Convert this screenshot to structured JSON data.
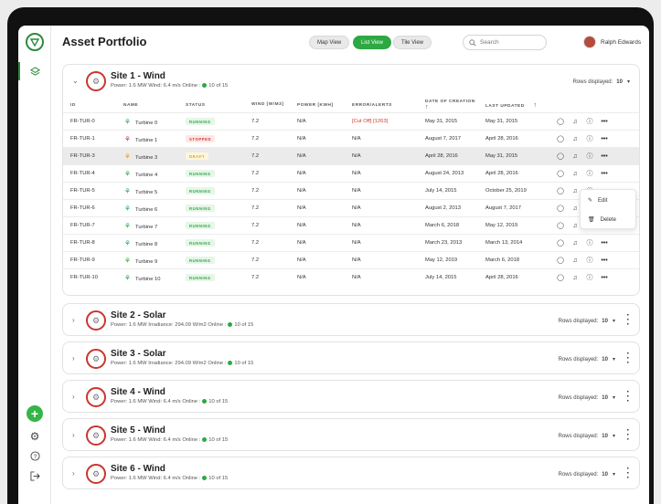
{
  "header": {
    "title": "Asset Portfolio",
    "views": [
      "Map View",
      "List View",
      "Tile View"
    ],
    "active_view": "List View",
    "search_placeholder": "Search",
    "user_name": "Ralph Edwards"
  },
  "colors": {
    "accent": "#2da843",
    "stopped": "#d33a2f",
    "draft": "#d9a321"
  },
  "expanded_site": {
    "name": "Site 1 - Wind",
    "power": "Power: 1.6 MW",
    "metric": "Wind: 6.4 m/s",
    "online_label": "Online :",
    "online_value": "10 of 15",
    "rows_label": "Rows displayed:",
    "rows_value": "10",
    "columns": [
      "ID",
      "NAME",
      "STATUS",
      "WIND [W/M3]",
      "POWER [KWH]",
      "ERROR/ALERTS",
      "DATE OF CREATION",
      "LAST UPDATED"
    ],
    "rows": [
      {
        "id": "FR-TUR-0",
        "name": "Turbine 0",
        "status": "RUNNING",
        "kind": "run",
        "wind": "7.2",
        "power": "N/A",
        "error": "[Cut Off] [1263]",
        "created": "May 31, 2015",
        "updated": "May 31, 2015"
      },
      {
        "id": "FR-TUR-1",
        "name": "Turbine 1",
        "status": "STOPPED",
        "kind": "stop",
        "wind": "7.2",
        "power": "N/A",
        "error": "N/A",
        "created": "August 7, 2017",
        "updated": "April 28, 2016"
      },
      {
        "id": "FR-TUR-3",
        "name": "Turbine 3",
        "status": "DRAFT",
        "kind": "draft",
        "wind": "7.2",
        "power": "N/A",
        "error": "N/A",
        "created": "April 28, 2016",
        "updated": "May 31, 2015"
      },
      {
        "id": "FR-TUR-4",
        "name": "Turbine 4",
        "status": "RUNNING",
        "kind": "run",
        "wind": "7.2",
        "power": "N/A",
        "error": "N/A",
        "created": "August 24, 2013",
        "updated": "April 28, 2016"
      },
      {
        "id": "FR-TUR-5",
        "name": "Turbine 5",
        "status": "RUNNING",
        "kind": "run",
        "wind": "7.2",
        "power": "N/A",
        "error": "N/A",
        "created": "July 14, 2015",
        "updated": "October 25, 2019"
      },
      {
        "id": "FR-TUR-6",
        "name": "Turbine 6",
        "status": "RUNNING",
        "kind": "run",
        "wind": "7.2",
        "power": "N/A",
        "error": "N/A",
        "created": "August 2, 2013",
        "updated": "August 7, 2017"
      },
      {
        "id": "FR-TUR-7",
        "name": "Turbine 7",
        "status": "RUNNING",
        "kind": "run",
        "wind": "7.2",
        "power": "N/A",
        "error": "N/A",
        "created": "March 6, 2018",
        "updated": "May 12, 2019"
      },
      {
        "id": "FR-TUR-8",
        "name": "Turbine 8",
        "status": "RUNNING",
        "kind": "run",
        "wind": "7.2",
        "power": "N/A",
        "error": "N/A",
        "created": "March 23, 2013",
        "updated": "March 13, 2014"
      },
      {
        "id": "FR-TUR-9",
        "name": "Turbine 9",
        "status": "RUNNING",
        "kind": "run",
        "wind": "7.2",
        "power": "N/A",
        "error": "N/A",
        "created": "May 12, 2019",
        "updated": "March 6, 2018"
      },
      {
        "id": "FR-TUR-10",
        "name": "Turbine 10",
        "status": "RUNNING",
        "kind": "run",
        "wind": "7.2",
        "power": "N/A",
        "error": "N/A",
        "created": "July 14, 2015",
        "updated": "April 28, 2016"
      }
    ],
    "menu": {
      "edit": "Edit",
      "delete": "Delete"
    }
  },
  "collapsed_sites": [
    {
      "name": "Site 2 - Solar",
      "power": "Power: 1.6 MW",
      "metric": "Irradiance: 294.09 W/m2",
      "online_label": "Online :",
      "online_value": "10 of 15",
      "rows_label": "Rows displayed:",
      "rows_value": "10"
    },
    {
      "name": "Site 3 - Solar",
      "power": "Power: 1.6 MW",
      "metric": "Irradiance: 294.09 W/m2",
      "online_label": "Online :",
      "online_value": "10 of 15",
      "rows_label": "Rows displayed:",
      "rows_value": "10"
    },
    {
      "name": "Site 4 - Wind",
      "power": "Power: 1.6 MW",
      "metric": "Wind: 6.4 m/s",
      "online_label": "Online :",
      "online_value": "10 of 15",
      "rows_label": "Rows displayed:",
      "rows_value": "10"
    },
    {
      "name": "Site 5 - Wind",
      "power": "Power: 1.6 MW",
      "metric": "Wind: 6.4 m/s",
      "online_label": "Online :",
      "online_value": "10 of 15",
      "rows_label": "Rows displayed:",
      "rows_value": "10"
    },
    {
      "name": "Site 6 - Wind",
      "power": "Power: 1.6 MW",
      "metric": "Wind: 6.4 m/s",
      "online_label": "Online :",
      "online_value": "10 of 15",
      "rows_label": "Rows displayed:",
      "rows_value": "10"
    }
  ]
}
